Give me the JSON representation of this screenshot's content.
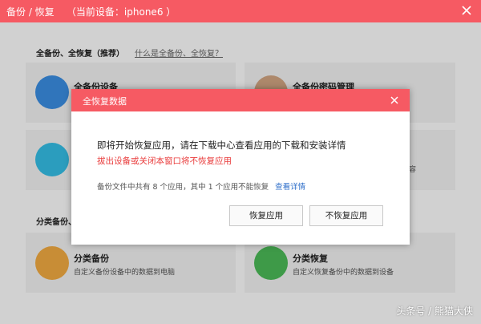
{
  "window": {
    "title": "备份 / 恢复    （当前设备：iphone6 ）"
  },
  "main": {
    "section1_label": "全备份、全恢复（推荐）",
    "section1_link": "什么是全备份、全恢复？",
    "section2_label": "分类备份、",
    "cards": [
      {
        "title": "全备份设备",
        "desc": "",
        "color": "#3b8fe4"
      },
      {
        "title": "全备份密码管理",
        "desc": "",
        "color": "#d3a683"
      },
      {
        "title": "",
        "desc": "",
        "color": "#35c0e8"
      },
      {
        "title": "",
        "desc": "容",
        "color": "#bbbbbb"
      },
      {
        "title": "分类备份",
        "desc": "自定义备份设备中的数据到电脑",
        "color": "#f5ad42"
      },
      {
        "title": "分类恢复",
        "desc": "自定义恢复备份中的数据到设备",
        "color": "#4cbc58"
      }
    ]
  },
  "dialog": {
    "title": "全恢复数据",
    "message": "即将开始恢复应用，请在下载中心查看应用的下载和安装详情",
    "warning": "拔出设备或关闭本窗口将不恢复应用",
    "info": "备份文件中共有 8 个应用，其中 1 个应用不能恢复",
    "info_link": "查看详情",
    "restore_button": "恢复应用",
    "skip_button": "不恢复应用"
  },
  "watermark": "头条号 / 熊猫大侠",
  "colors": {
    "accent": "#f65a63",
    "warning": "#e93b3b",
    "link": "#2d6ec9"
  }
}
